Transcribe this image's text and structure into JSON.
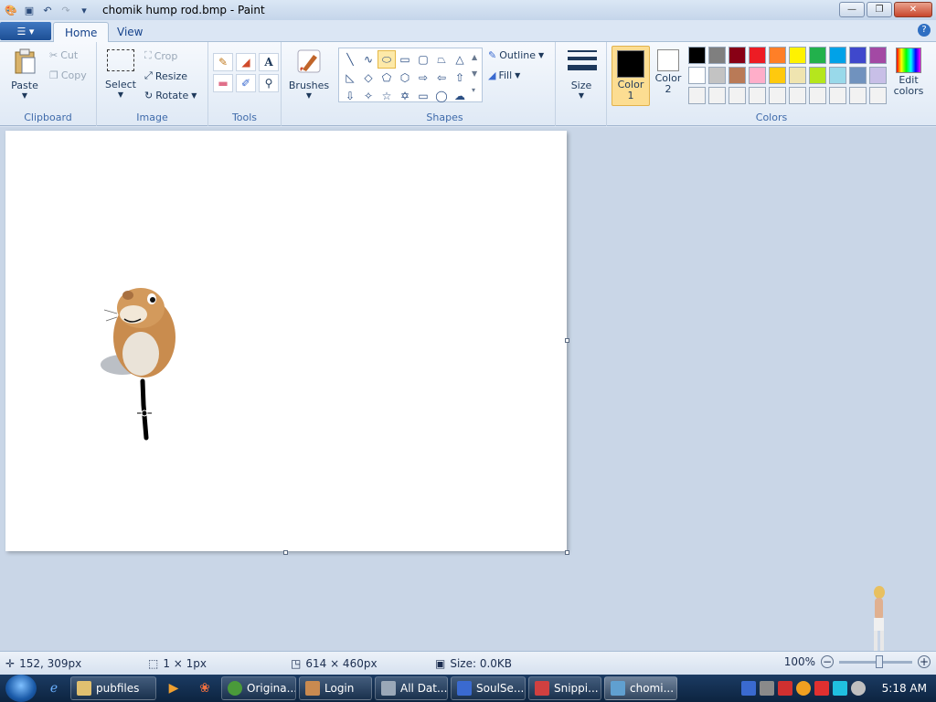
{
  "window": {
    "title": "chomik hump rod.bmp - Paint"
  },
  "tabs": [
    {
      "label": "Home"
    },
    {
      "label": "View"
    }
  ],
  "clipboard": {
    "group_label": "Clipboard",
    "paste": "Paste",
    "cut": "Cut",
    "copy": "Copy"
  },
  "image": {
    "group_label": "Image",
    "select": "Select",
    "crop": "Crop",
    "resize": "Resize",
    "rotate": "Rotate"
  },
  "tools": {
    "group_label": "Tools"
  },
  "brushes": {
    "label": "Brushes"
  },
  "shapes": {
    "group_label": "Shapes",
    "outline": "Outline",
    "fill": "Fill"
  },
  "size": {
    "label": "Size"
  },
  "colors": {
    "group_label": "Colors",
    "color1_label": "Color 1",
    "color2_label": "Color 2",
    "edit_colors": "Edit colors",
    "color1": "#000000",
    "color2": "#ffffff",
    "palette": [
      "#000000",
      "#7f7f7f",
      "#880015",
      "#ed1c24",
      "#ff7f27",
      "#fff200",
      "#22b14c",
      "#00a2e8",
      "#3f48cc",
      "#a349a4",
      "#ffffff",
      "#c3c3c3",
      "#b97a57",
      "#ffaec9",
      "#ffc90e",
      "#efe4b0",
      "#b5e61d",
      "#99d9ea",
      "#7092be",
      "#c8bfe7",
      "#f2f2f2",
      "#f2f2f2",
      "#f2f2f2",
      "#f2f2f2",
      "#f2f2f2",
      "#f2f2f2",
      "#f2f2f2",
      "#f2f2f2",
      "#f2f2f2",
      "#f2f2f2"
    ]
  },
  "status": {
    "cursor_pos": "152, 309px",
    "selection_size": "1 × 1px",
    "canvas_size": "614 × 460px",
    "file_size": "Size: 0.0KB",
    "zoom": "100%"
  },
  "taskbar": {
    "tasks": [
      {
        "label": "pubfiles",
        "color": "#e0c070"
      },
      {
        "label": "Origina...",
        "color": "#4a9a3a"
      },
      {
        "label": "Login",
        "color": "#c98a50"
      },
      {
        "label": "All Dat...",
        "color": "#9aa8b8"
      },
      {
        "label": "SoulSe...",
        "color": "#3a6ad0"
      },
      {
        "label": "Snippi...",
        "color": "#d04040"
      },
      {
        "label": "chomi...",
        "color": "#60a0d0"
      }
    ],
    "clock": "5:18 AM"
  }
}
